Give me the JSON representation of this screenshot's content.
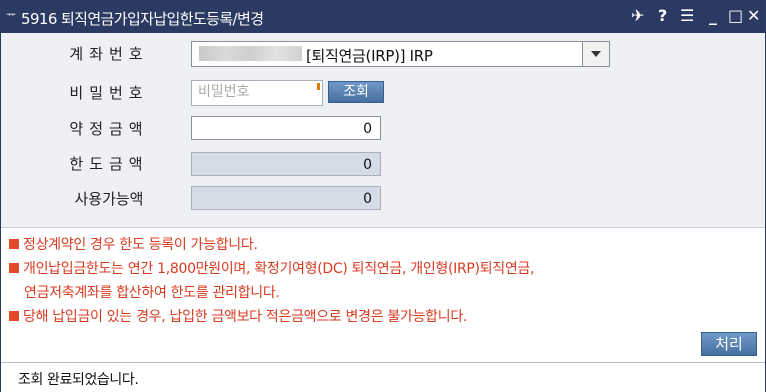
{
  "window": {
    "title": "5916 퇴직연금가입자납입한도등록/변경",
    "title_icon": "ᅲ",
    "controls": {
      "pin": "✈",
      "help": "?",
      "menu": "☰",
      "minimize": "_",
      "maximize": "□",
      "close": "✕"
    }
  },
  "form": {
    "account": {
      "label": "계좌번호",
      "value": "[퇴직연금(IRP)] IRP"
    },
    "password": {
      "label": "비밀번호",
      "placeholder": "비밀번호",
      "lookup_label": "조회"
    },
    "contract_amount": {
      "label": "약정금액",
      "value": "0"
    },
    "limit_amount": {
      "label": "한도금액",
      "value": "0"
    },
    "available_amount": {
      "label": "사용가능액",
      "value": "0"
    }
  },
  "notices": [
    "정상계약인 경우 한도 등록이 가능합니다.",
    "개인납입금한도는 연간 1,800만원이며, 확정기여형(DC) 퇴직연금, 개인형(IRP)퇴직연금,",
    "연금저축계좌를 합산하여 한도를 관리합니다.",
    "당해 납입금이 있는 경우, 납입한 금액보다 적은금액으로 변경은 불가능합니다."
  ],
  "process_button": "처리",
  "status_text": "조회 완료되었습니다.",
  "colors": {
    "titlebar": "#2b3a62",
    "notice_text": "#d83b20",
    "button_blue": "#5a82b4",
    "readonly_fill": "#d5dbe7"
  }
}
